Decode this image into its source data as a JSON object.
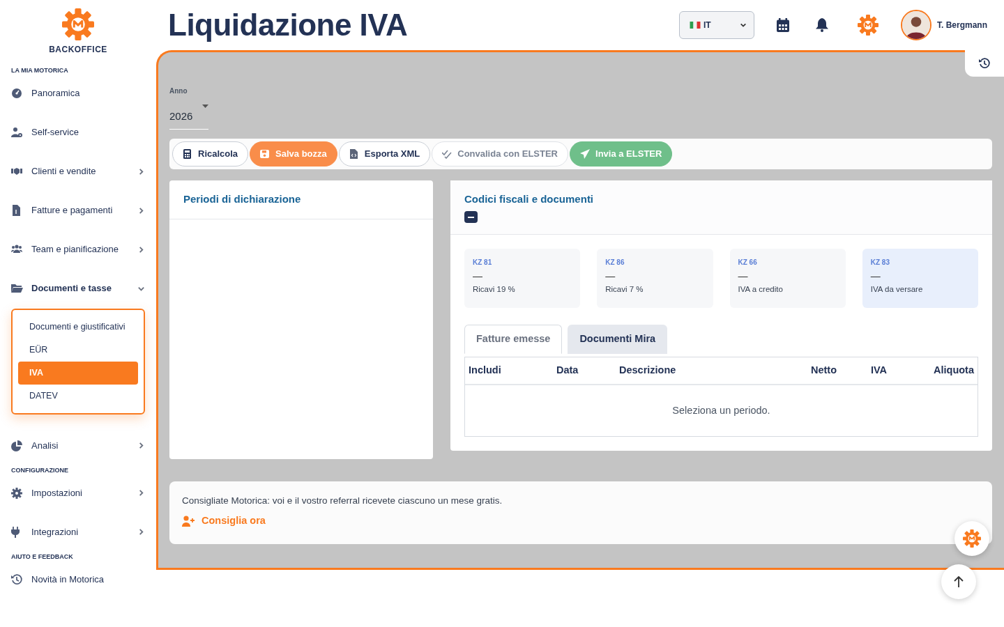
{
  "sidebar": {
    "brand": "BACKOFFICE",
    "sections": [
      {
        "heading": "LA MIA MOTORICA",
        "items": [
          {
            "label": "Panoramica",
            "expandable": false,
            "expanded": false
          },
          {
            "label": "Self-service",
            "expandable": false,
            "expanded": false
          },
          {
            "label": "Clienti e vendite",
            "expandable": true,
            "expanded": false
          },
          {
            "label": "Fatture e pagamenti",
            "expandable": true,
            "expanded": false
          },
          {
            "label": "Team e pianificazione",
            "expandable": true,
            "expanded": false
          },
          {
            "label": "Documenti e tasse",
            "expandable": true,
            "expanded": true,
            "children": [
              {
                "label": "Documenti e giustificativi",
                "selected": false
              },
              {
                "label": "EÜR",
                "selected": false
              },
              {
                "label": "IVA",
                "selected": true
              },
              {
                "label": "DATEV",
                "selected": false
              }
            ]
          },
          {
            "label": "Analisi",
            "expandable": true,
            "expanded": false
          }
        ]
      },
      {
        "heading": "CONFIGURAZIONE",
        "items": [
          {
            "label": "Impostazioni",
            "expandable": true,
            "expanded": false
          },
          {
            "label": "Integrazioni",
            "expandable": true,
            "expanded": false
          }
        ]
      },
      {
        "heading": "AIUTO E FEEDBACK",
        "items": [
          {
            "label": "Novità in Motorica",
            "expandable": false,
            "expanded": false
          }
        ]
      }
    ]
  },
  "header": {
    "title": "Liquidazione IVA",
    "language": "IT",
    "user": "T. Bergmann"
  },
  "year_field": {
    "label": "Anno",
    "value": "2026"
  },
  "toolbar": [
    {
      "label": "Ricalcola",
      "kind": "outline"
    },
    {
      "label": "Salva bozza",
      "kind": "primary"
    },
    {
      "label": "Esporta XML",
      "kind": "outline"
    },
    {
      "label": "Convalida con ELSTER",
      "kind": "disabled"
    },
    {
      "label": "Invia a ELSTER",
      "kind": "success"
    }
  ],
  "periods_card": {
    "title": "Periodi di dichiarazione"
  },
  "codes_card": {
    "title": "Codici fiscali e documenti",
    "tiles": [
      {
        "code": "KZ 81",
        "value": "—",
        "label": "Ricavi 19 %",
        "highlighted": false
      },
      {
        "code": "KZ 86",
        "value": "—",
        "label": "Ricavi 7 %",
        "highlighted": false
      },
      {
        "code": "KZ 66",
        "value": "—",
        "label": "IVA a credito",
        "highlighted": false
      },
      {
        "code": "KZ 83",
        "value": "—",
        "label": "IVA da versare",
        "highlighted": true
      }
    ],
    "tabs": [
      {
        "label": "Fatture emesse",
        "selected": true
      },
      {
        "label": "Documenti Mira",
        "selected": false
      }
    ],
    "table": {
      "columns": [
        "Includi",
        "Data",
        "Descrizione",
        "Netto",
        "IVA",
        "Aliquota"
      ],
      "empty_message": "Seleziona un periodo."
    }
  },
  "referral": {
    "text": "Consigliate Motorica: voi e il vostro referral ricevete ciascuno un mese gratis.",
    "link": "Consiglia ora"
  }
}
